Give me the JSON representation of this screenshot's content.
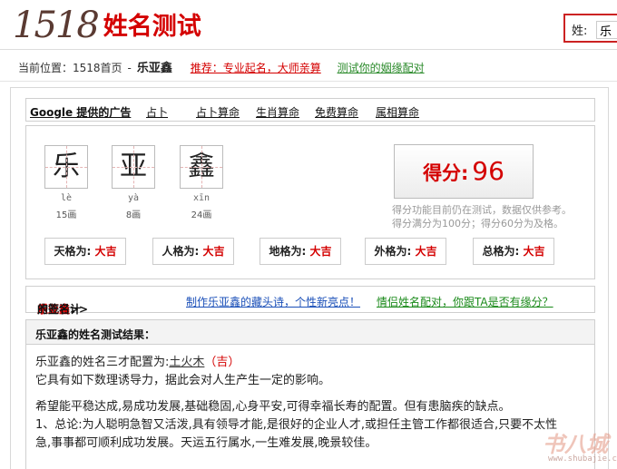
{
  "header": {
    "logo_number": "1518",
    "logo_title": "姓名测试",
    "search_label": "姓:",
    "search_value": "乐"
  },
  "breadcrumb": {
    "prefix": "当前位置：1518首页",
    "separator": "-",
    "name": "乐亚鑫",
    "recommend_link": "推荐：专业起名，大师亲算",
    "marriage_link": "测试你的姻缘配对"
  },
  "adbar": {
    "google_ads": "Google 提供的广告",
    "links": [
      "占卜",
      "占卜算命",
      "生肖算命",
      "免费算命",
      "属相算命"
    ]
  },
  "characters": [
    {
      "char": "乐",
      "pinyin": "lè",
      "strokes": "15画"
    },
    {
      "char": "亚",
      "pinyin": "yà",
      "strokes": "8画"
    },
    {
      "char": "鑫",
      "pinyin": "xīn",
      "strokes": "24画"
    }
  ],
  "score": {
    "label": "得分:",
    "value": "96",
    "note_line1": "得分功能目前仍在测试，数据仅供参考。",
    "note_line2": "得分满分为100分；得分60分为及格。"
  },
  "ge": [
    {
      "label": "天格为:",
      "value": "大吉"
    },
    {
      "label": "人格为:",
      "value": "大吉"
    },
    {
      "label": "地格为:",
      "value": "大吉"
    },
    {
      "label": "外格为:",
      "value": "大吉"
    },
    {
      "label": "总格为:",
      "value": "大吉"
    }
  ],
  "design_bar": {
    "design_prefix": "点此设计",
    "design_name": "乐亚鑫",
    "design_suffix": "的签名>>",
    "poem_link": "制作乐亚鑫的藏头诗，个性新亮点！",
    "love_link": "情侣姓名配对，你跟TA是否有缘分？"
  },
  "result": {
    "heading": "乐亚鑫的姓名测试结果：",
    "sancai_prefix": "乐亚鑫的姓名三才配置为:",
    "sancai_wuxing": "土火木",
    "sancai_ji": "（吉）",
    "line2": "它具有如下数理诱导力，据此会对人生产生一定的影响。",
    "line3": "希望能平稳达成,易成功发展,基础稳固,心身平安,可得幸福长寿的配置。但有患脑疾的缺点。",
    "line4": "1、总论:为人聪明急智又活泼,具有领导才能,是很好的企业人才,或担任主管工作都很适合,只要不太性",
    "line5": "急,事事都可顺利成功发展。天运五行属水,一生难发展,晚景较佳。"
  },
  "watermark": {
    "text": "书八城",
    "url": "www.shubajie.com"
  }
}
